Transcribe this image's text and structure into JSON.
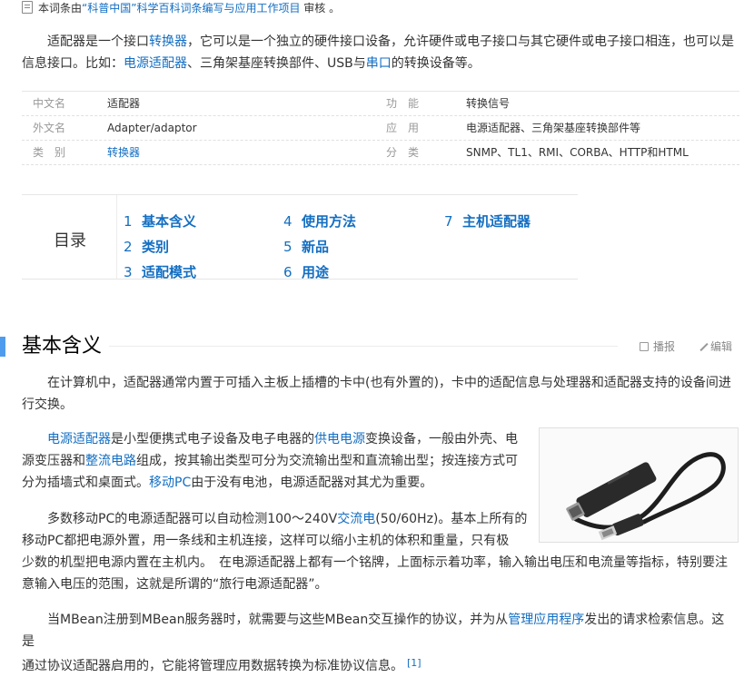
{
  "review": {
    "pre": "本词条由",
    "link": "“科普中国”科学百科词条编写与应用工作项目",
    "post": " 审核 。"
  },
  "intro": {
    "t1": "适配器是一个接口",
    "l1": "转换器",
    "t2": "，它可以是一个独立的硬件接口设备，允许硬件或电子接口与其它硬件或电子接口相连，也可以是信息接口。比如：",
    "l2": "电源适配器",
    "t3": "、三角架基座转换部件、USB与",
    "l3": "串口",
    "t4": "的转换设备等。"
  },
  "info": {
    "rows": [
      {
        "k": "中文名",
        "v": "适配器",
        "k2": "功　能",
        "v2": "转换信号"
      },
      {
        "k": "外文名",
        "v": "Adapter/adaptor",
        "k2": "应　用",
        "v2": "电源适配器、三角架基座转换部件等"
      },
      {
        "k": "类　别",
        "v": "转换器",
        "k2": "分　类",
        "v2": "SNMP、TL1、RMI、CORBA、HTTP和HTML"
      }
    ]
  },
  "toc": {
    "title": "目录",
    "items": [
      {
        "num": "1",
        "label": "基本含义"
      },
      {
        "num": "2",
        "label": "类别"
      },
      {
        "num": "3",
        "label": "适配模式"
      },
      {
        "num": "4",
        "label": "使用方法"
      },
      {
        "num": "5",
        "label": "新品"
      },
      {
        "num": "6",
        "label": "用途"
      },
      {
        "num": "7",
        "label": "主机适配器"
      }
    ]
  },
  "section": {
    "title": "基本含义",
    "play": "播报",
    "edit": "编辑"
  },
  "p1": "在计算机中，适配器通常内置于可插入主板上插槽的卡中(也有外置的)，卡中的适配信息与处理器和适配器支持的设备间进行交换。",
  "p2": {
    "l1": "电源适配器",
    "t1": "是小型便携式电子设备及电子电器的",
    "l2": "供电电源",
    "t2": "变换设备，一般由外壳、电",
    "t3": "源变压器和",
    "l3": "整流电路",
    "t4": "组成，按其输出类型可分为交流输出型和直流输出型；按连接方式可",
    "t5": "分为插墙式和桌面式。",
    "l4": "移动PC",
    "t6": "由于没有电池，电源适配器对其尤为重要。"
  },
  "p3": {
    "t1": "多数移动PC的电源适配器可以自动检测100～240V",
    "l1": "交流电",
    "t2": "(50/60Hz)。基本上所有的",
    "t3": "移动PC都把电源外置，用一条线和主机连接，这样可以缩小主机的体积和重量，只有极",
    "t4": "少数的机型把电源内置在主机内。　在电源适配器上都有一个铭牌，上面标示着功率，输入输出电压和电流量等指标，特别要注",
    "t5": "意输入电压的范围，这就是所谓的“旅行电源适配器”。"
  },
  "p4": {
    "t1": "当MBean注册到MBean服务器时，就需要与这些MBean交互操作的协议，并为从",
    "l1": "管理应用程序",
    "t2": "发出的请求检索信息。这是",
    "t3": "通过协议适配器启用的，它能将管理应用数据转换为标准协议信息。",
    "ref": "[1]"
  },
  "colors": {
    "link": "#136ec2",
    "section_bar": "#4f9cee"
  }
}
